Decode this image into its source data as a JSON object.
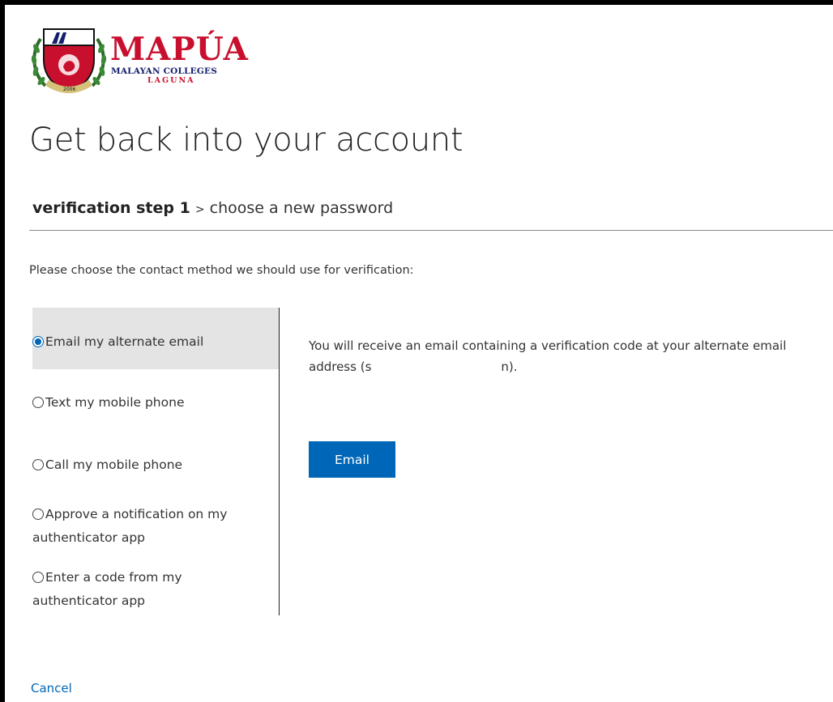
{
  "logo": {
    "name": "MAPÚA",
    "line2": "MALAYAN COLLEGES",
    "line3": "LAGUNA",
    "seal_year": "2006",
    "seal_letters": "M"
  },
  "page": {
    "title": "Get back into your account",
    "step_current": "verification step 1",
    "step_separator": ">",
    "step_next": "choose a new password",
    "prompt": "Please choose the contact method we should use for verification:"
  },
  "options": [
    {
      "label": "Email my alternate email",
      "selected": true
    },
    {
      "label": "Text my mobile phone",
      "selected": false
    },
    {
      "label": "Call my mobile phone",
      "selected": false
    },
    {
      "label": "Approve a notification on my authenticator app",
      "selected": false
    },
    {
      "label": "Enter a code from my authenticator app",
      "selected": false
    }
  ],
  "detail": {
    "text_before": "You will receive an email containing a verification code at your alternate email address (",
    "redacted_start": "s",
    "redacted_end": "n",
    "text_after": ")."
  },
  "email_button": "Email",
  "cancel_link": "Cancel",
  "colors": {
    "accent": "#0067b8",
    "brand_red": "#c8102e",
    "brand_navy": "#14206b",
    "selected_bg": "#e4e4e4"
  }
}
